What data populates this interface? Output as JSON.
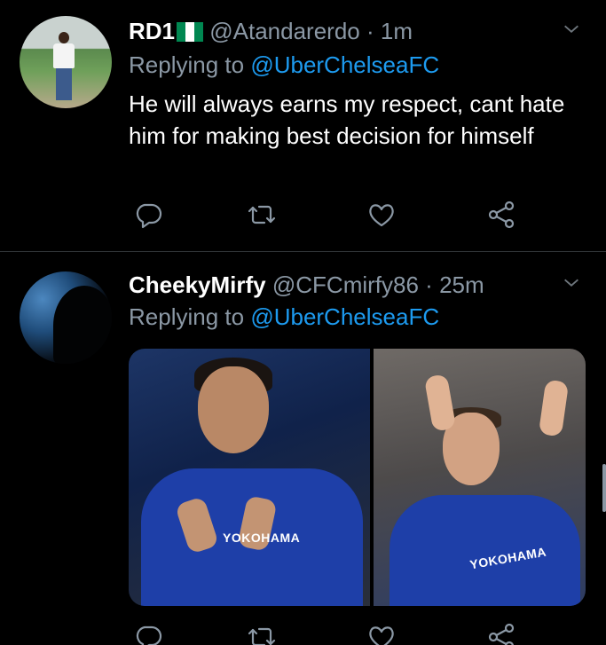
{
  "tweets": [
    {
      "name": "RD1",
      "handle": "@Atandarerdo",
      "dot": "·",
      "time": "1m",
      "replying_prefix": "Replying to ",
      "replying_to": "@UberChelseaFC",
      "text": "He will always earns my respect, cant hate him for making best decision for himself"
    },
    {
      "name": "CheekyMirfy",
      "handle": "@CFCmirfy86",
      "dot": "·",
      "time": "25m",
      "replying_prefix": "Replying to ",
      "replying_to": "@UberChelseaFC",
      "media": [
        {
          "sponsor": "YOKOHAMA"
        },
        {
          "sponsor": "YOKOHAMA"
        }
      ]
    }
  ],
  "icons": [
    "reply-icon",
    "retweet-icon",
    "like-icon",
    "share-icon",
    "chevron-down-icon",
    "nigeria-flag-icon"
  ],
  "colors": {
    "background": "#000000",
    "link": "#1d9bf0",
    "muted": "#8b98a5"
  }
}
